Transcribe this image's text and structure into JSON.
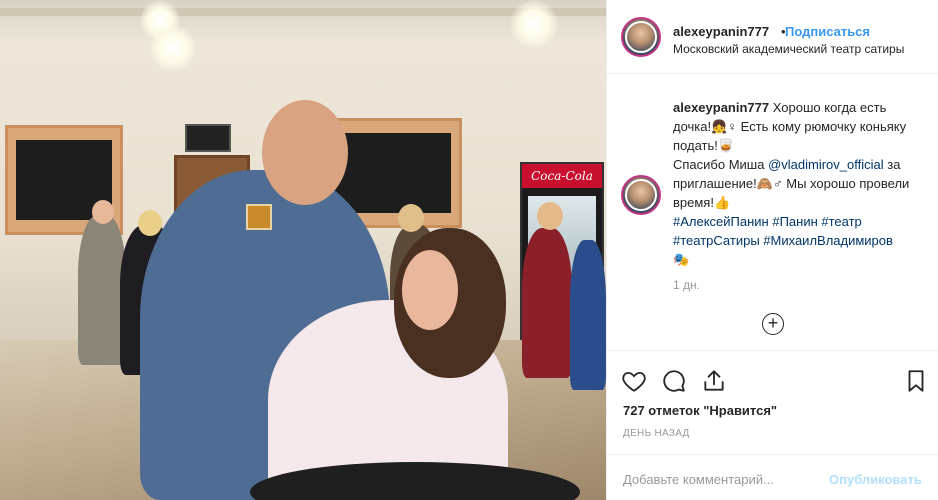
{
  "post": {
    "username": "alexeypanin777",
    "separator": "•",
    "follow_label": "Подписаться",
    "location": "Московский академический театр сатиры"
  },
  "caption": {
    "username": "alexeypanin777",
    "line1": "Хорошо когда есть дочка!👧♀ Есть кому рюмочку коньяку подать!🥃",
    "line2_pre": "Спасибо Миша ",
    "mention": "@vladimirov_official",
    "line2_post": " за приглашение!🙈♂ Мы хорошо провели время!👍",
    "hashtags": "#АлексейПанин #Панин #театр #театрСатиры #МихаилВладимиров",
    "emoji_end": "🎭",
    "time_ago": "1 дн."
  },
  "actions": {
    "like_icon": "heart-icon",
    "comment_icon": "comment-icon",
    "share_icon": "share-icon",
    "save_icon": "bookmark-icon",
    "likes_text": "727 отметок \"Нравится\"",
    "date_text": "ДЕНЬ НАЗАД"
  },
  "add_comment": {
    "placeholder": "Добавьте комментарий...",
    "post_label": "Опубликовать"
  },
  "photo": {
    "sign_text": "Coca-Cola"
  },
  "colors": {
    "link": "#3897f0",
    "mention": "#003569",
    "muted": "#999999",
    "post_disabled": "#b2dffc",
    "avatar_ring": "#c13584"
  }
}
